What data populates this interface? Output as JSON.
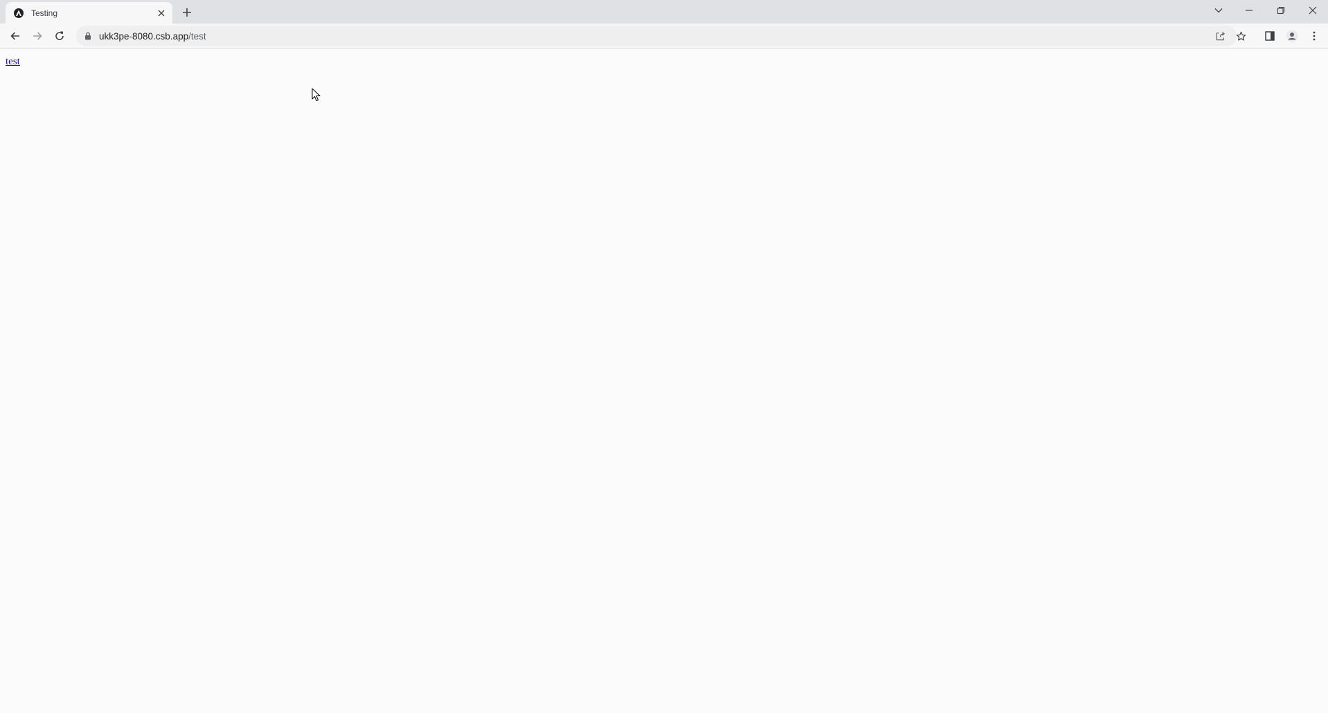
{
  "browser": {
    "tab": {
      "title": "Testing",
      "favicon": "app-favicon-icon"
    },
    "new_tab_icon": "plus-icon",
    "window_controls": [
      "chevron-down-icon",
      "minimize-icon",
      "restore-icon",
      "close-icon"
    ],
    "toolbar": {
      "back_icon": "arrow-left-icon",
      "forward_icon": "arrow-right-icon",
      "reload_icon": "reload-icon",
      "url_host": "ukk3pe-8080.csb.app",
      "url_path": "/test",
      "share_icon": "share-icon",
      "bookmark_icon": "star-icon",
      "side_panel_icon": "side-panel-icon",
      "profile_icon": "profile-icon",
      "menu_icon": "kebab-menu-icon"
    }
  },
  "page": {
    "link_text": "test"
  },
  "colors": {
    "tabstrip_bg": "#dfe1e5",
    "toolbar_bg": "#f7f7f7",
    "omnibox_bg": "#efefef",
    "page_bg": "#fbfbfb",
    "link": "#1a0dab"
  }
}
